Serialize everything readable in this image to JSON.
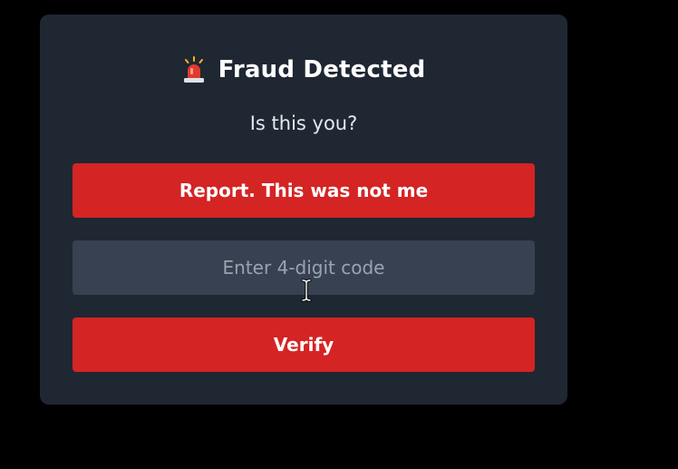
{
  "dialog": {
    "title": "Fraud Detected",
    "title_icon": "siren-icon",
    "subtitle": "Is this you?",
    "report_button_label": "Report. This was not me",
    "code_input": {
      "placeholder": "Enter 4-digit code",
      "value": ""
    },
    "verify_button_label": "Verify"
  },
  "colors": {
    "page_background": "#000000",
    "dialog_background": "#1f2733",
    "input_background": "#374151",
    "button_red": "#d42424",
    "text_white": "#ffffff",
    "placeholder_gray": "#9aa3b0"
  },
  "pointer": {
    "icon": "text-cursor-icon"
  }
}
